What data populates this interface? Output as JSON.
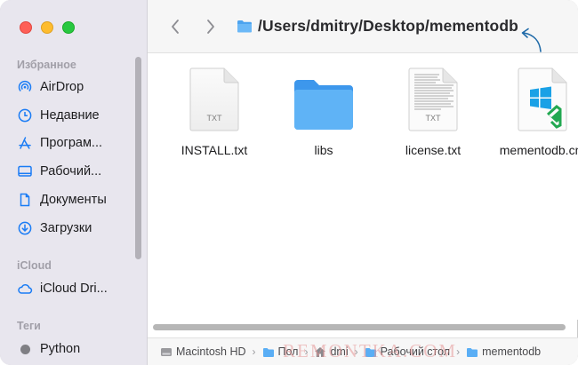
{
  "window": {
    "path": "/Users/dmitry/Desktop/mementodb"
  },
  "sidebar": {
    "favorites_header": "Избранное",
    "favorites": [
      {
        "label": "AirDrop",
        "icon": "airdrop-icon"
      },
      {
        "label": "Недавние",
        "icon": "clock-icon"
      },
      {
        "label": "Програм...",
        "icon": "applications-icon"
      },
      {
        "label": "Рабочий...",
        "icon": "desktop-icon"
      },
      {
        "label": "Документы",
        "icon": "document-icon"
      },
      {
        "label": "Загрузки",
        "icon": "download-icon"
      }
    ],
    "icloud_header": "iCloud",
    "icloud": [
      {
        "label": "iCloud Dri...",
        "icon": "cloud-icon"
      }
    ],
    "tags_header": "Теги",
    "tags": [
      {
        "label": "Python",
        "color": "#7f7f84"
      }
    ]
  },
  "files": [
    {
      "name": "INSTALL.txt",
      "type": "txt",
      "badge": "TXT"
    },
    {
      "name": "libs",
      "type": "folder"
    },
    {
      "name": "license.txt",
      "type": "txt-preview",
      "badge": "TXT"
    },
    {
      "name": "mementodb.cm",
      "type": "cmd"
    }
  ],
  "pathbar": {
    "items": [
      "Macintosh HD",
      "Пол",
      "dmi",
      "Рабочий стол",
      "mementodb"
    ]
  },
  "watermark": "REMONTKA.COM",
  "colors": {
    "accent": "#1a7cf5",
    "folder": "#5aaef5",
    "sidebar_bg": "#e8e6ee"
  }
}
